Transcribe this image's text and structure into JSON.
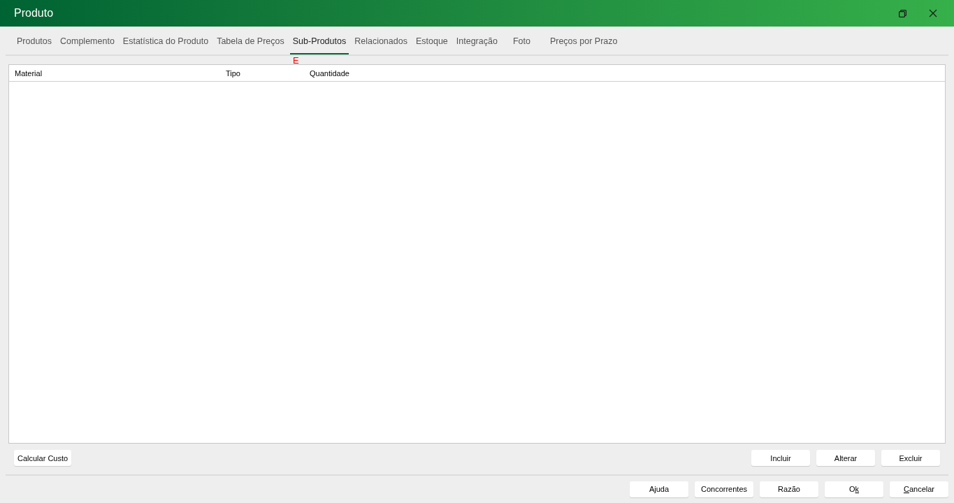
{
  "window": {
    "title": "Produto"
  },
  "tabs": [
    {
      "label": "Produtos",
      "selected": false
    },
    {
      "label": "Complemento",
      "selected": false
    },
    {
      "label": "Estatística do Produto",
      "selected": false
    },
    {
      "label": "Tabela de Preços",
      "selected": false
    },
    {
      "label": "Sub-Produtos",
      "selected": true
    },
    {
      "label": "Relacionados",
      "selected": false
    },
    {
      "label": "Estoque",
      "selected": false
    },
    {
      "label": "Integração",
      "selected": false
    },
    {
      "label": "Foto",
      "selected": false
    },
    {
      "label": "Preços por Prazo",
      "selected": false
    }
  ],
  "marker": "E",
  "table": {
    "columns": [
      "Material",
      "Tipo",
      "Quantidade"
    ]
  },
  "left_buttons": [
    "Calcular Custo"
  ],
  "row_buttons": [
    "Incluir",
    "Alterar",
    "Excluir"
  ],
  "footer_buttons": [
    {
      "parts": [
        {
          "text": "Ajuda",
          "underlined": false
        }
      ]
    },
    {
      "parts": [
        {
          "text": "Concorrentes",
          "underlined": false
        }
      ]
    },
    {
      "parts": [
        {
          "text": "Razão",
          "underlined": false
        }
      ]
    },
    {
      "parts": [
        {
          "text": "O",
          "underlined": false
        },
        {
          "text": "k",
          "underlined": true
        }
      ]
    },
    {
      "parts": [
        {
          "text": "C",
          "underlined": true
        },
        {
          "text": "ancelar",
          "underlined": false
        }
      ]
    }
  ]
}
